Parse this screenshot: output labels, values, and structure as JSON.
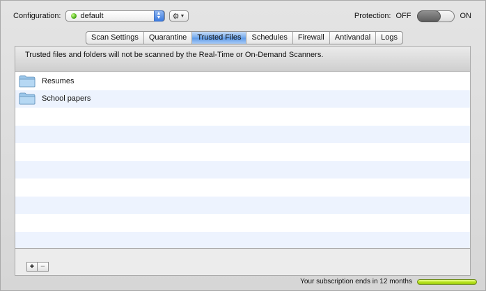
{
  "header": {
    "configuration_label": "Configuration:",
    "configuration_value": "default",
    "gear_menu_icon": "gear-icon",
    "protection_label": "Protection:",
    "protection_off": "OFF",
    "protection_on": "ON",
    "protection_enabled": false
  },
  "tabs": [
    {
      "label": "Scan Settings",
      "active": false
    },
    {
      "label": "Quarantine",
      "active": false
    },
    {
      "label": "Trusted Files",
      "active": true
    },
    {
      "label": "Schedules",
      "active": false
    },
    {
      "label": "Firewall",
      "active": false
    },
    {
      "label": "Antivandal",
      "active": false
    },
    {
      "label": "Logs",
      "active": false
    }
  ],
  "trusted": {
    "info_text": "Trusted files and folders will not be scanned by the Real-Time or On-Demand Scanners.",
    "items": [
      {
        "name": "Resumes",
        "icon": "folder-icon"
      },
      {
        "name": "School papers",
        "icon": "folder-icon"
      }
    ],
    "add_label": "+",
    "remove_label": "−"
  },
  "footer": {
    "subscription_text": "Your subscription ends in 12 months",
    "subscription_remaining": 1.0
  },
  "colors": {
    "status_green": "#4fb11a",
    "active_tab": "#73a9ec",
    "subscription_bar": "#b8e21d"
  }
}
